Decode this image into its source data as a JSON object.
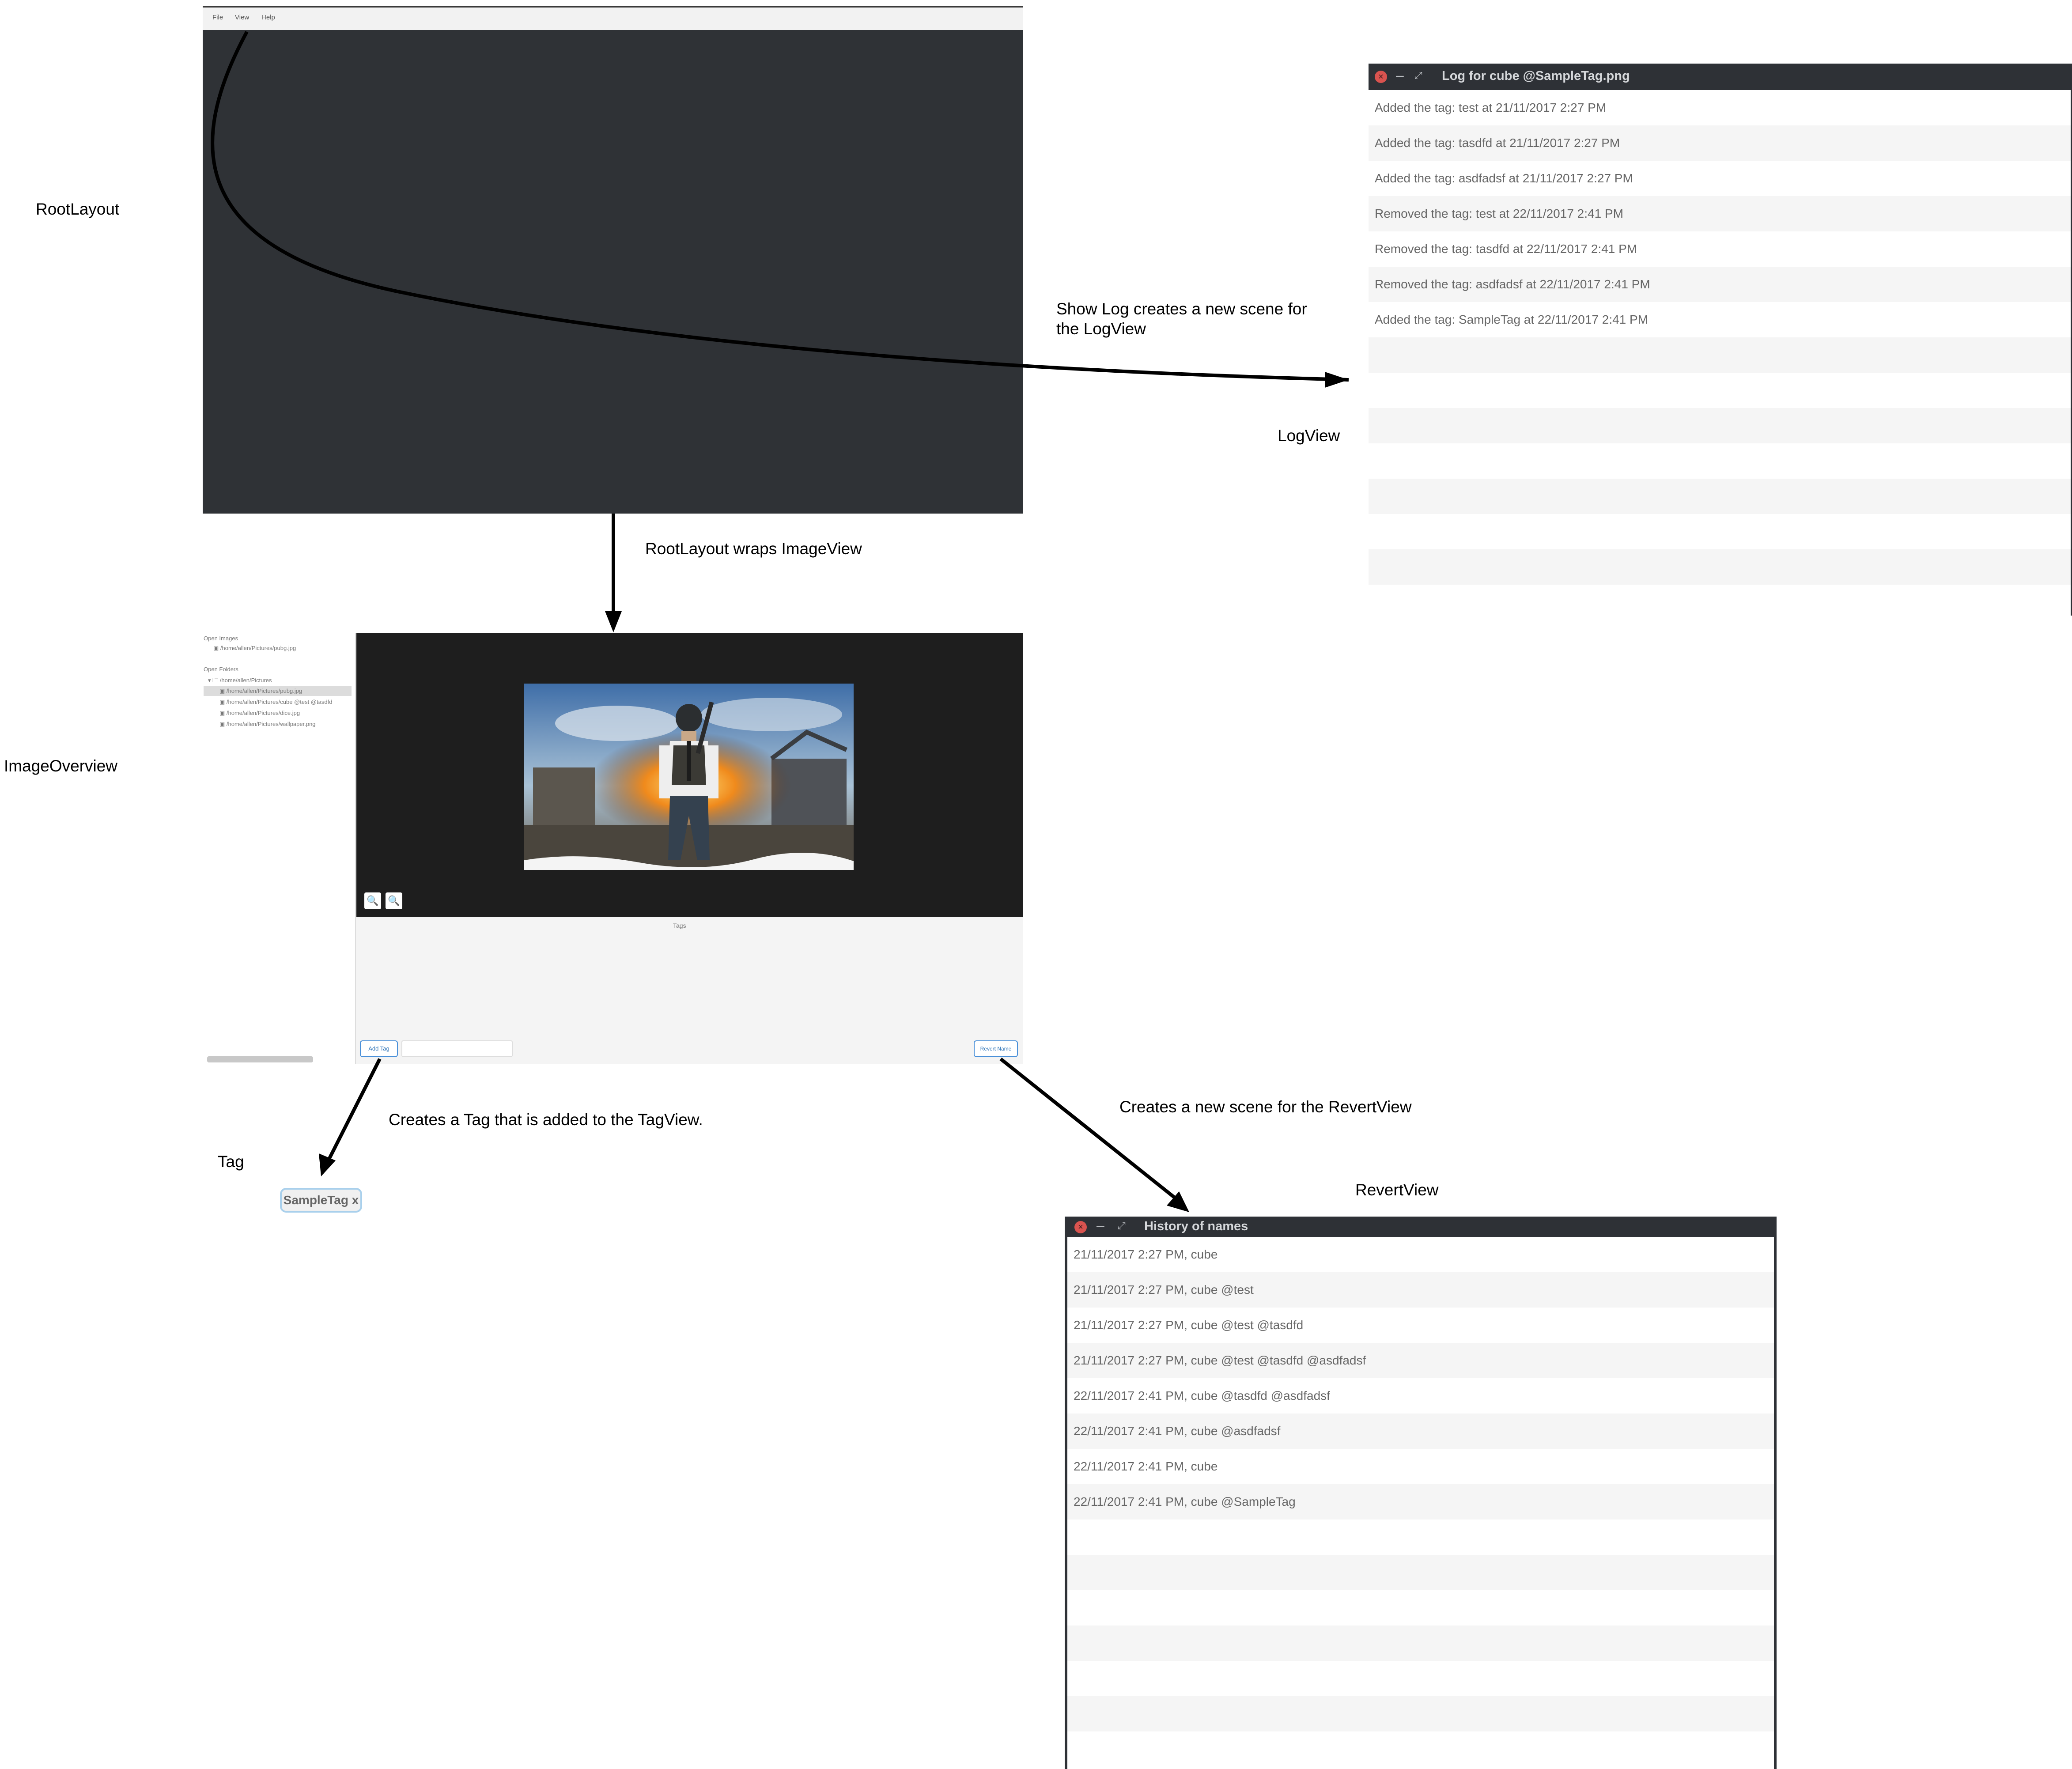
{
  "captions": {
    "root_layout": "RootLayout",
    "log_view": "LogView",
    "image_overview": "ImageOverview",
    "tag": "Tag",
    "revert_view": "RevertView",
    "show_log": "Show Log creates a new scene for",
    "show_log_2": "the LogView",
    "wraps": "RootLayout wraps ImageView",
    "creates_tag": "Creates a Tag that is added to the TagView.",
    "creates_revert": "Creates a new scene for the RevertView"
  },
  "root_menu": {
    "file": "File",
    "view": "View",
    "help": "Help"
  },
  "log_window": {
    "title": "Log for cube @SampleTag.png",
    "entries": [
      "Added the tag: test at 21/11/2017 2:27 PM",
      "Added the tag: tasdfd at 21/11/2017 2:27 PM",
      "Added the tag: asdfadsf at 21/11/2017 2:27 PM",
      "Removed the tag: test at 22/11/2017 2:41 PM",
      "Removed the tag: tasdfd at 22/11/2017 2:41 PM",
      "Removed the tag: asdfadsf at 22/11/2017 2:41 PM",
      "Added the tag: SampleTag at 22/11/2017 2:41 PM"
    ]
  },
  "overview": {
    "open_images_label": "Open Images",
    "open_images": [
      "/home/allen/Pictures/pubg.jpg"
    ],
    "open_folders_label": "Open Folders",
    "folder": "/home/allen/Pictures",
    "files": [
      "/home/allen/Pictures/pubg.jpg",
      "/home/allen/Pictures/cube @test @tasdfd",
      "/home/allen/Pictures/dice.jpg",
      "/home/allen/Pictures/wallpaper.png"
    ],
    "tags_label": "Tags",
    "add_tag": "Add Tag",
    "revert_name": "Revert Name",
    "zoom_in_icon": "zoom-in-icon",
    "zoom_out_icon": "zoom-out-icon"
  },
  "sample_tag": "SampleTag x",
  "revert_window": {
    "title": "History of names",
    "entries": [
      "21/11/2017 2:27 PM, cube",
      "21/11/2017 2:27 PM, cube @test",
      "21/11/2017 2:27 PM, cube @test @tasdfd",
      "21/11/2017 2:27 PM, cube @test @tasdfd @asdfadsf",
      "22/11/2017 2:41 PM, cube @tasdfd @asdfadsf",
      "22/11/2017 2:41 PM, cube @asdfadsf",
      "22/11/2017 2:41 PM, cube",
      "22/11/2017 2:41 PM, cube @SampleTag"
    ]
  },
  "colors": {
    "dark_panel": "#2f3236",
    "accent": "#4a90d9",
    "close": "#d9534f"
  }
}
